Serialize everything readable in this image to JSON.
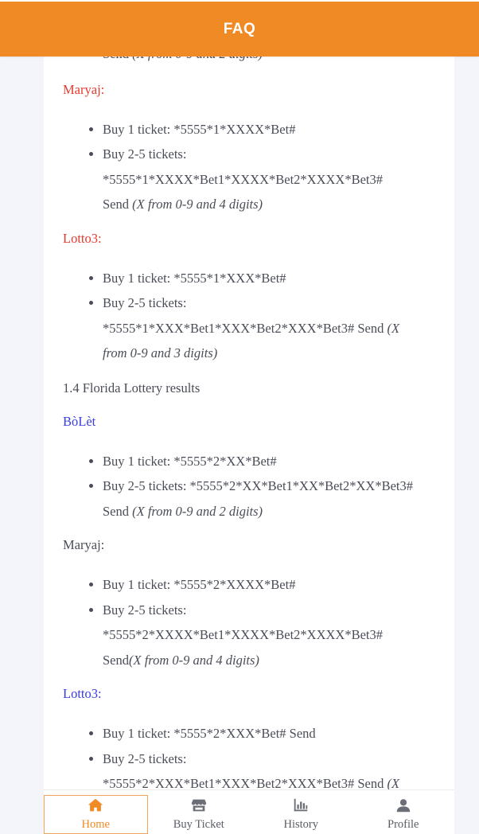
{
  "header": {
    "title": "FAQ"
  },
  "content": {
    "partial_top": {
      "text": "Send ",
      "italic": "(X from 0-9 and 2 digits)"
    },
    "haiti_maryaj": {
      "heading": "Maryaj:",
      "items": [
        {
          "text": "Buy 1 ticket: *5555*1*XXXX*Bet#"
        },
        {
          "text": "Buy 2-5 tickets:",
          "line2": "*5555*1*XXXX*Bet1*XXXX*Bet2*XXXX*Bet3#",
          "line3": "Send ",
          "italic": "(X from 0-9 and 4 digits)"
        }
      ]
    },
    "haiti_lotto3": {
      "heading": "Lotto3:",
      "items": [
        {
          "text": "Buy 1 ticket: *5555*1*XXX*Bet#"
        },
        {
          "text": "Buy 2-5 tickets:",
          "line2": "*5555*1*XXX*Bet1*XXX*Bet2*XXX*Bet3# Send ",
          "italic2": "(X",
          "line3_italic": "from 0-9 and 3 digits)"
        }
      ]
    },
    "section_title": "1.4 Florida Lottery results",
    "florida_bolet": {
      "heading": "BòLèt",
      "items": [
        {
          "text": "Buy 1 ticket: *5555*2*XX*Bet#"
        },
        {
          "text": "Buy 2-5 tickets: *5555*2*XX*Bet1*XX*Bet2*XX*Bet3#",
          "line2": "Send ",
          "italic": "(X from 0-9 and 2 digits)"
        }
      ]
    },
    "florida_maryaj": {
      "heading": "Maryaj:",
      "items": [
        {
          "text": "Buy 1 ticket: *5555*2*XXXX*Bet#"
        },
        {
          "text": "Buy 2-5 tickets:",
          "line2": "*5555*2*XXXX*Bet1*XXXX*Bet2*XXXX*Bet3#",
          "line3": "Send",
          "italic": "(X from 0-9 and 4 digits)"
        }
      ]
    },
    "florida_lotto3": {
      "heading": "Lotto3:",
      "items": [
        {
          "text": "Buy 1 ticket: *5555*2*XXX*Bet# Send"
        },
        {
          "text": "Buy 2-5 tickets:",
          "line2": "*5555*2*XXX*Bet1*XXX*Bet2*XXX*Bet3# Send ",
          "italic2": "(X"
        }
      ]
    }
  },
  "tabbar": {
    "tabs": [
      {
        "label": "Home",
        "icon": "home-icon",
        "active": true
      },
      {
        "label": "Buy Ticket",
        "icon": "store-icon",
        "active": false
      },
      {
        "label": "History",
        "icon": "bar-chart-icon",
        "active": false
      },
      {
        "label": "Profile",
        "icon": "user-icon",
        "active": false
      }
    ]
  },
  "colors": {
    "accent": "#f08a24",
    "heading_red": "#e53a2e",
    "heading_blue": "#3a3de0",
    "text": "#4a4d57"
  }
}
